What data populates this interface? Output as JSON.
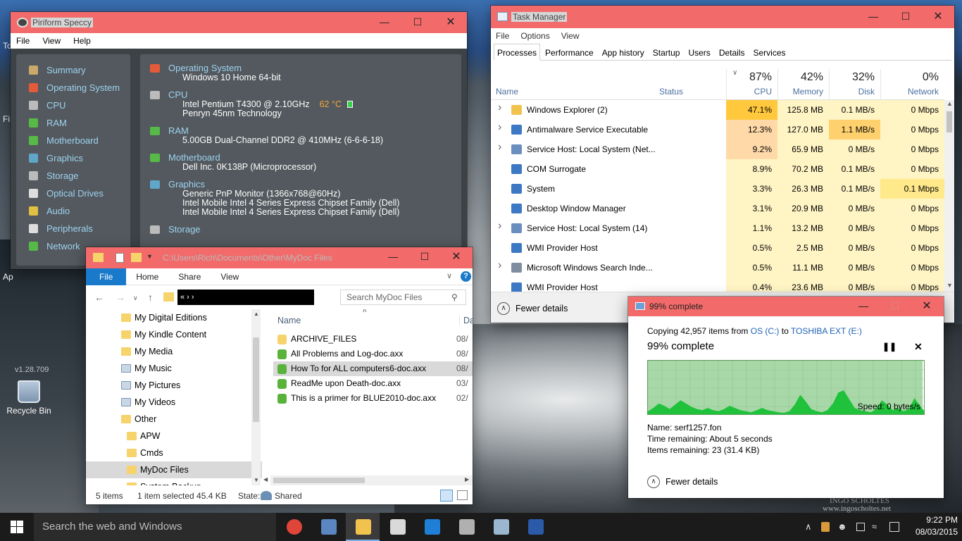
{
  "speccy": {
    "title": "Piriform Speccy",
    "menu": [
      "File",
      "View",
      "Help"
    ],
    "nav": [
      {
        "label": "Summary",
        "icon": "summary-icon",
        "color": "#c9a86a"
      },
      {
        "label": "Operating System",
        "icon": "windows-icon",
        "color": "#e45a3a"
      },
      {
        "label": "CPU",
        "icon": "cpu-icon",
        "color": "#bbbbbb"
      },
      {
        "label": "RAM",
        "icon": "ram-icon",
        "color": "#57b947"
      },
      {
        "label": "Motherboard",
        "icon": "motherboard-icon",
        "color": "#57b947"
      },
      {
        "label": "Graphics",
        "icon": "graphics-icon",
        "color": "#5fa6c9"
      },
      {
        "label": "Storage",
        "icon": "storage-icon",
        "color": "#bbbbbb"
      },
      {
        "label": "Optical Drives",
        "icon": "optical-drive-icon",
        "color": "#dddddd"
      },
      {
        "label": "Audio",
        "icon": "audio-icon",
        "color": "#e0c040"
      },
      {
        "label": "Peripherals",
        "icon": "mouse-icon",
        "color": "#dddddd"
      },
      {
        "label": "Network",
        "icon": "network-icon",
        "color": "#57b947"
      }
    ],
    "sections": [
      {
        "heading": "Operating System",
        "icon": "windows-icon",
        "color": "#e45a3a",
        "lines": [
          "Windows 10 Home 64-bit"
        ]
      },
      {
        "heading": "CPU",
        "icon": "cpu-icon",
        "color": "#bbbbbb",
        "lines": [
          "Intel Pentium T4300 @ 2.10GHz",
          "Penryn 45nm Technology"
        ]
      },
      {
        "heading": "RAM",
        "icon": "ram-icon",
        "color": "#57b947",
        "lines": [
          "5.00GB Dual-Channel DDR2 @ 410MHz (6-6-6-18)"
        ]
      },
      {
        "heading": "Motherboard",
        "icon": "motherboard-icon",
        "color": "#57b947",
        "lines": [
          "Dell Inc. 0K138P (Microprocessor)"
        ]
      },
      {
        "heading": "Graphics",
        "icon": "graphics-icon",
        "color": "#5fa6c9",
        "lines": [
          "Generic PnP Monitor (1366x768@60Hz)",
          "Intel Mobile Intel 4 Series Express Chipset Family (Dell)",
          "Intel Mobile Intel 4 Series Express Chipset Family (Dell)"
        ]
      },
      {
        "heading": "Storage",
        "icon": "storage-icon",
        "color": "#bbbbbb",
        "lines": []
      }
    ],
    "cpu_temp": "62 °C",
    "version": "v1.28.709"
  },
  "taskmgr": {
    "title": "Task Manager",
    "menu": [
      "File",
      "Options",
      "View"
    ],
    "tabs": [
      "Processes",
      "Performance",
      "App history",
      "Startup",
      "Users",
      "Details",
      "Services"
    ],
    "columns": {
      "name": "Name",
      "status": "Status",
      "cpu": {
        "pct": "87%",
        "label": "CPU"
      },
      "memory": {
        "pct": "42%",
        "label": "Memory"
      },
      "disk": {
        "pct": "32%",
        "label": "Disk"
      },
      "network": {
        "pct": "0%",
        "label": "Network"
      }
    },
    "rows": [
      {
        "expand": true,
        "name": "Windows Explorer (2)",
        "cpu": "47.1%",
        "mem": "125.8 MB",
        "disk": "0.1 MB/s",
        "net": "0 Mbps",
        "icon": "explorer-icon",
        "icolor": "#f2c24e",
        "cpuColor": "#ffc83d",
        "diskColor": "#fff4c4"
      },
      {
        "expand": true,
        "name": "Antimalware Service Executable",
        "cpu": "12.3%",
        "mem": "127.0 MB",
        "disk": "1.1 MB/s",
        "net": "0 Mbps",
        "icon": "app-icon",
        "icolor": "#3c78c4",
        "cpuColor": "#ffd9a8",
        "diskColor": "#ffd06e"
      },
      {
        "expand": true,
        "name": "Service Host: Local System (Net...",
        "cpu": "9.2%",
        "mem": "65.9 MB",
        "disk": "0 MB/s",
        "net": "0 Mbps",
        "icon": "gear-icon",
        "icolor": "#6a8fbf",
        "cpuColor": "#ffd9a8",
        "diskColor": "#fff4c4"
      },
      {
        "expand": false,
        "name": "COM Surrogate",
        "cpu": "8.9%",
        "mem": "70.2 MB",
        "disk": "0.1 MB/s",
        "net": "0 Mbps",
        "icon": "app-icon",
        "icolor": "#3c78c4",
        "cpuColor": "#fff4c4",
        "diskColor": "#fff4c4"
      },
      {
        "expand": false,
        "name": "System",
        "cpu": "3.3%",
        "mem": "26.3 MB",
        "disk": "0.1 MB/s",
        "net": "0.1 Mbps",
        "icon": "app-icon",
        "icolor": "#3c78c4",
        "cpuColor": "#fff4c4",
        "diskColor": "#fff4c4"
      },
      {
        "expand": false,
        "name": "Desktop Window Manager",
        "cpu": "3.1%",
        "mem": "20.9 MB",
        "disk": "0 MB/s",
        "net": "0 Mbps",
        "icon": "app-icon",
        "icolor": "#3c78c4",
        "cpuColor": "#fff4c4",
        "diskColor": "#fff4c4"
      },
      {
        "expand": true,
        "name": "Service Host: Local System (14)",
        "cpu": "1.1%",
        "mem": "13.2 MB",
        "disk": "0 MB/s",
        "net": "0 Mbps",
        "icon": "gear-icon",
        "icolor": "#6a8fbf",
        "cpuColor": "#fff4c4",
        "diskColor": "#fff4c4"
      },
      {
        "expand": false,
        "name": "WMI Provider Host",
        "cpu": "0.5%",
        "mem": "2.5 MB",
        "disk": "0 MB/s",
        "net": "0 Mbps",
        "icon": "app-icon",
        "icolor": "#3c78c4",
        "cpuColor": "#fff4c4",
        "diskColor": "#fff4c4"
      },
      {
        "expand": true,
        "name": "Microsoft Windows Search Inde...",
        "cpu": "0.5%",
        "mem": "11.1 MB",
        "disk": "0 MB/s",
        "net": "0 Mbps",
        "icon": "search-indexer-icon",
        "icolor": "#7f8da0",
        "cpuColor": "#fff4c4",
        "diskColor": "#fff4c4"
      },
      {
        "expand": false,
        "name": "WMI Provider Host",
        "cpu": "0.4%",
        "mem": "23.6 MB",
        "disk": "0 MB/s",
        "net": "0 Mbps",
        "icon": "app-icon",
        "icolor": "#3c78c4",
        "cpuColor": "#fff4c4",
        "diskColor": "#fff4c4"
      }
    ],
    "fewer_details": "Fewer details"
  },
  "explorer": {
    "title": "C:\\Users\\Rich\\Documents\\Other\\MyDoc Files",
    "ribbon": [
      "File",
      "Home",
      "Share",
      "View"
    ],
    "address_trail": "« › ›",
    "search_placeholder": "Search MyDoc Files",
    "tree": [
      {
        "label": "My Digital Editions",
        "indent": 0,
        "icon": "folder-icon"
      },
      {
        "label": "My Kindle Content",
        "indent": 0,
        "icon": "folder-icon"
      },
      {
        "label": "My Media",
        "indent": 0,
        "icon": "folder-icon"
      },
      {
        "label": "My Music",
        "indent": 0,
        "icon": "music-folder-icon"
      },
      {
        "label": "My Pictures",
        "indent": 0,
        "icon": "pictures-folder-icon"
      },
      {
        "label": "My Videos",
        "indent": 0,
        "icon": "videos-folder-icon"
      },
      {
        "label": "Other",
        "indent": 0,
        "icon": "folder-icon"
      },
      {
        "label": "APW",
        "indent": 1,
        "icon": "folder-icon"
      },
      {
        "label": "Cmds",
        "indent": 1,
        "icon": "folder-icon"
      },
      {
        "label": "MyDoc Files",
        "indent": 1,
        "icon": "folder-icon",
        "selected": true
      },
      {
        "label": "System Backup",
        "indent": 1,
        "icon": "folder-icon"
      }
    ],
    "col_name": "Name",
    "col_date": "Dat",
    "files": [
      {
        "name": "ARCHIVE_FILES",
        "date": "08/",
        "icon": "folder-icon",
        "color": "#f6d36b"
      },
      {
        "name": "All Problems and Log-doc.axx",
        "date": "08/",
        "icon": "axcrypt-file-icon",
        "color": "#59b33b"
      },
      {
        "name": "How To for ALL computers6-doc.axx",
        "date": "08/",
        "icon": "axcrypt-file-icon",
        "color": "#59b33b",
        "selected": true
      },
      {
        "name": "ReadMe upon Death-doc.axx",
        "date": "03/",
        "icon": "axcrypt-file-icon",
        "color": "#59b33b"
      },
      {
        "name": "This is a primer for BLUE2010-doc.axx",
        "date": "02/",
        "icon": "axcrypt-file-icon",
        "color": "#59b33b"
      }
    ],
    "status": {
      "count": "5 items",
      "selected": "1 item selected  45.4 KB",
      "state_label": "State:",
      "state_value": "Shared"
    }
  },
  "copy": {
    "title": "99% complete",
    "copying_prefix": "Copying 42,957 items from",
    "source": "OS (C:)",
    "to": "to",
    "dest": "TOSHIBA EXT (E:)",
    "heading": "99% complete",
    "speed": "Speed: 0 bytes/s",
    "name": "Name:  serf1257.fon",
    "time_remaining": "Time remaining:  About 5 seconds",
    "items_remaining": "Items remaining:  23 (31.4 KB)",
    "fewer_details": "Fewer details",
    "progress_fraction": 0.99,
    "throughput": [
      0.08,
      0.14,
      0.22,
      0.18,
      0.12,
      0.2,
      0.28,
      0.22,
      0.16,
      0.12,
      0.1,
      0.14,
      0.1,
      0.08,
      0.12,
      0.18,
      0.14,
      0.1,
      0.08,
      0.06,
      0.1,
      0.14,
      0.1,
      0.08,
      0.06,
      0.05,
      0.08,
      0.2,
      0.38,
      0.26,
      0.12,
      0.08,
      0.06,
      0.1,
      0.22,
      0.42,
      0.46,
      0.3,
      0.14,
      0.1,
      0.08,
      0.06,
      0.12,
      0.28,
      0.2,
      0.1,
      0.14,
      0.08,
      0.12,
      0.32,
      0.18,
      0.06
    ]
  },
  "desktop": {
    "recycle_bin": "Recycle Bin",
    "edge_label_1": "To",
    "edge_label_2": "Fi",
    "edge_label_3": "Ap",
    "watermark_1": "INGO SCHOLTES",
    "watermark_2": "www.ingoscholtes.net"
  },
  "taskbar": {
    "search": "Search the web and Windows",
    "apps": [
      {
        "name": "chrome-icon",
        "color": "#e0453a"
      },
      {
        "name": "thunderbird-icon",
        "color": "#5c86c2"
      },
      {
        "name": "file-explorer-icon",
        "color": "#f2c24e",
        "active": true
      },
      {
        "name": "calculator-icon",
        "color": "#d9d9d9"
      },
      {
        "name": "edge-icon",
        "color": "#1f7fd6"
      },
      {
        "name": "app-icon",
        "color": "#b0b0b0"
      },
      {
        "name": "app-icon",
        "color": "#9ab7cf"
      },
      {
        "name": "word-icon",
        "color": "#2b5aa8"
      }
    ],
    "time": "9:22 PM",
    "date": "08/03/2015"
  }
}
